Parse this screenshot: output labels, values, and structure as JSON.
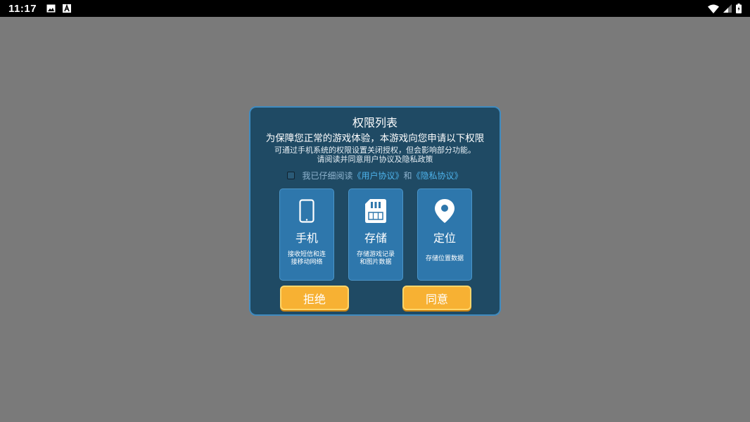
{
  "status_bar": {
    "time": "11:17",
    "left_icons": [
      "image-icon",
      "text-a-icon"
    ],
    "right_icons": [
      "wifi-icon",
      "signal-icon",
      "battery-icon"
    ]
  },
  "dialog": {
    "title": "权限列表",
    "subtitle": "为保障您正常的游戏体验，本游戏向您申请以下权限",
    "note_line1": "可通过手机系统的权限设置关闭授权，但会影响部分功能。",
    "note_line2": "请阅读并同意用户协议及隐私政策",
    "agreement": {
      "checked": false,
      "prefix": "我已仔细阅读",
      "user_agreement": "《用户协议》",
      "and": "和",
      "privacy_policy": "《隐私协议》"
    },
    "permissions": [
      {
        "icon": "phone-icon",
        "name": "手机",
        "desc_line1": "接收短信和连",
        "desc_line2": "接移动网络"
      },
      {
        "icon": "sd-card-icon",
        "name": "存储",
        "desc_line1": "存储游戏记录",
        "desc_line2": "和图片数据"
      },
      {
        "icon": "location-pin-icon",
        "name": "定位",
        "desc_line1": "存储位置数据"
      }
    ],
    "reject_label": "拒绝",
    "accept_label": "同意"
  },
  "colors": {
    "dialog_bg": "#1f4a64",
    "dialog_border": "#3f8bc0",
    "card_bg": "#2e77ac",
    "button_bg": "#f7b133",
    "link": "#4db3ec"
  }
}
